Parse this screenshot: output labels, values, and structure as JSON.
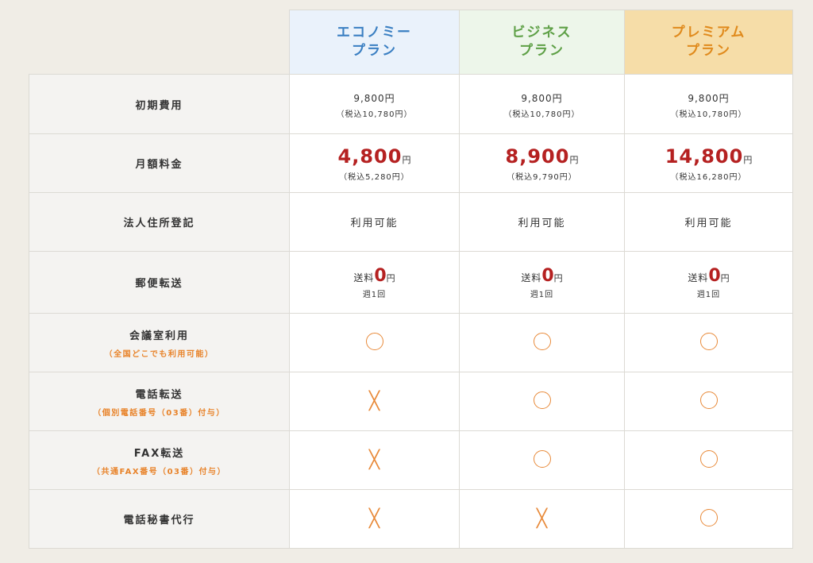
{
  "plans": {
    "economy": [
      "エコノミー",
      "プラン"
    ],
    "business": [
      "ビジネス",
      "プラン"
    ],
    "premium": [
      "プレミアム",
      "プラン"
    ]
  },
  "rows": {
    "initial_fee": {
      "label": "初期費用",
      "values": [
        {
          "price": "9,800円",
          "tax": "（税込10,780円）"
        },
        {
          "price": "9,800円",
          "tax": "（税込10,780円）"
        },
        {
          "price": "9,800円",
          "tax": "（税込10,780円）"
        }
      ]
    },
    "monthly_fee": {
      "label": "月額料金",
      "yen": "円",
      "values": [
        {
          "amount": "4,800",
          "tax": "（税込5,280円）"
        },
        {
          "amount": "8,900",
          "tax": "（税込9,790円）"
        },
        {
          "amount": "14,800",
          "tax": "（税込16,280円）"
        }
      ]
    },
    "corporate_address": {
      "label": "法人住所登記",
      "values": [
        "利用可能",
        "利用可能",
        "利用可能"
      ]
    },
    "mail_forwarding": {
      "label": "郵便転送",
      "prefix": "送料",
      "amount": "0",
      "yen": "円",
      "frequency": "週1回"
    },
    "meeting_room": {
      "label": "会議室利用",
      "note": "（全国どこでも利用可能）",
      "values": [
        "available",
        "available",
        "available"
      ]
    },
    "phone_forwarding": {
      "label": "電話転送",
      "note": "（個別電話番号（03番）付与）",
      "values": [
        "unavailable",
        "available",
        "available"
      ]
    },
    "fax_forwarding": {
      "label": "FAX転送",
      "note": "（共通FAX番号（03番）付与）",
      "values": [
        "unavailable",
        "available",
        "available"
      ]
    },
    "phone_secretary": {
      "label": "電話秘書代行",
      "values": [
        "unavailable",
        "unavailable",
        "available"
      ]
    }
  },
  "marks": {
    "available": "circle-icon",
    "unavailable": "cross-icon"
  },
  "colors": {
    "economy": "#3a7fc2",
    "business": "#5ea046",
    "premium": "#e08a1c",
    "price_red": "#b52121",
    "accent_orange": "#e8832a"
  }
}
